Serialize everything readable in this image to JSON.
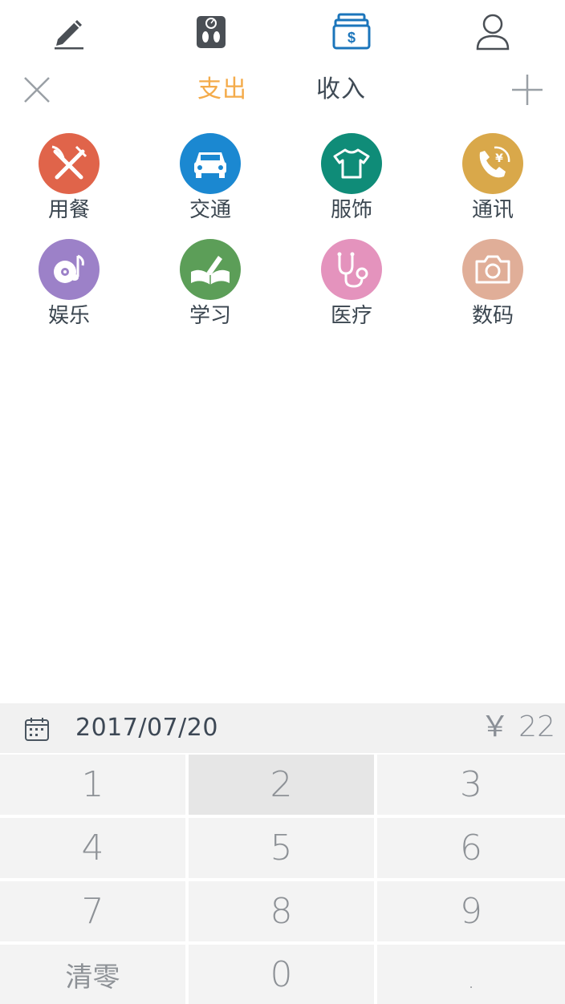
{
  "top_nav": {
    "items": [
      {
        "name": "record",
        "icon": "pencil-icon"
      },
      {
        "name": "weight",
        "icon": "scale-icon"
      },
      {
        "name": "bookkeeping",
        "icon": "cash-register-icon",
        "active": true
      },
      {
        "name": "profile",
        "icon": "person-icon"
      }
    ],
    "active_color": "#1b75bb",
    "inactive_color": "#4a4f55"
  },
  "header": {
    "tabs": [
      {
        "label": "支出",
        "active": true
      },
      {
        "label": "收入",
        "active": false
      }
    ],
    "active_color": "#f4ab4a"
  },
  "categories": [
    {
      "label": "用餐",
      "icon": "fork-knife-icon",
      "color": "#e0644a"
    },
    {
      "label": "交通",
      "icon": "car-icon",
      "color": "#1b88d1"
    },
    {
      "label": "服饰",
      "icon": "tshirt-icon",
      "color": "#0f8c78"
    },
    {
      "label": "通讯",
      "icon": "phone-yuan-icon",
      "color": "#d9a84a"
    },
    {
      "label": "娱乐",
      "icon": "music-disc-icon",
      "color": "#9c81c8"
    },
    {
      "label": "学习",
      "icon": "book-pen-icon",
      "color": "#5c9e58"
    },
    {
      "label": "医疗",
      "icon": "stethoscope-icon",
      "color": "#e493bd"
    },
    {
      "label": "数码",
      "icon": "camera-icon",
      "color": "#e0ae98"
    }
  ],
  "entry": {
    "date": "2017/07/20",
    "amount": "￥ 22"
  },
  "keypad": {
    "keys": [
      "1",
      "2",
      "3",
      "4",
      "5",
      "6",
      "7",
      "8",
      "9",
      "清零",
      "0",
      "."
    ],
    "pressed_key": "2"
  }
}
